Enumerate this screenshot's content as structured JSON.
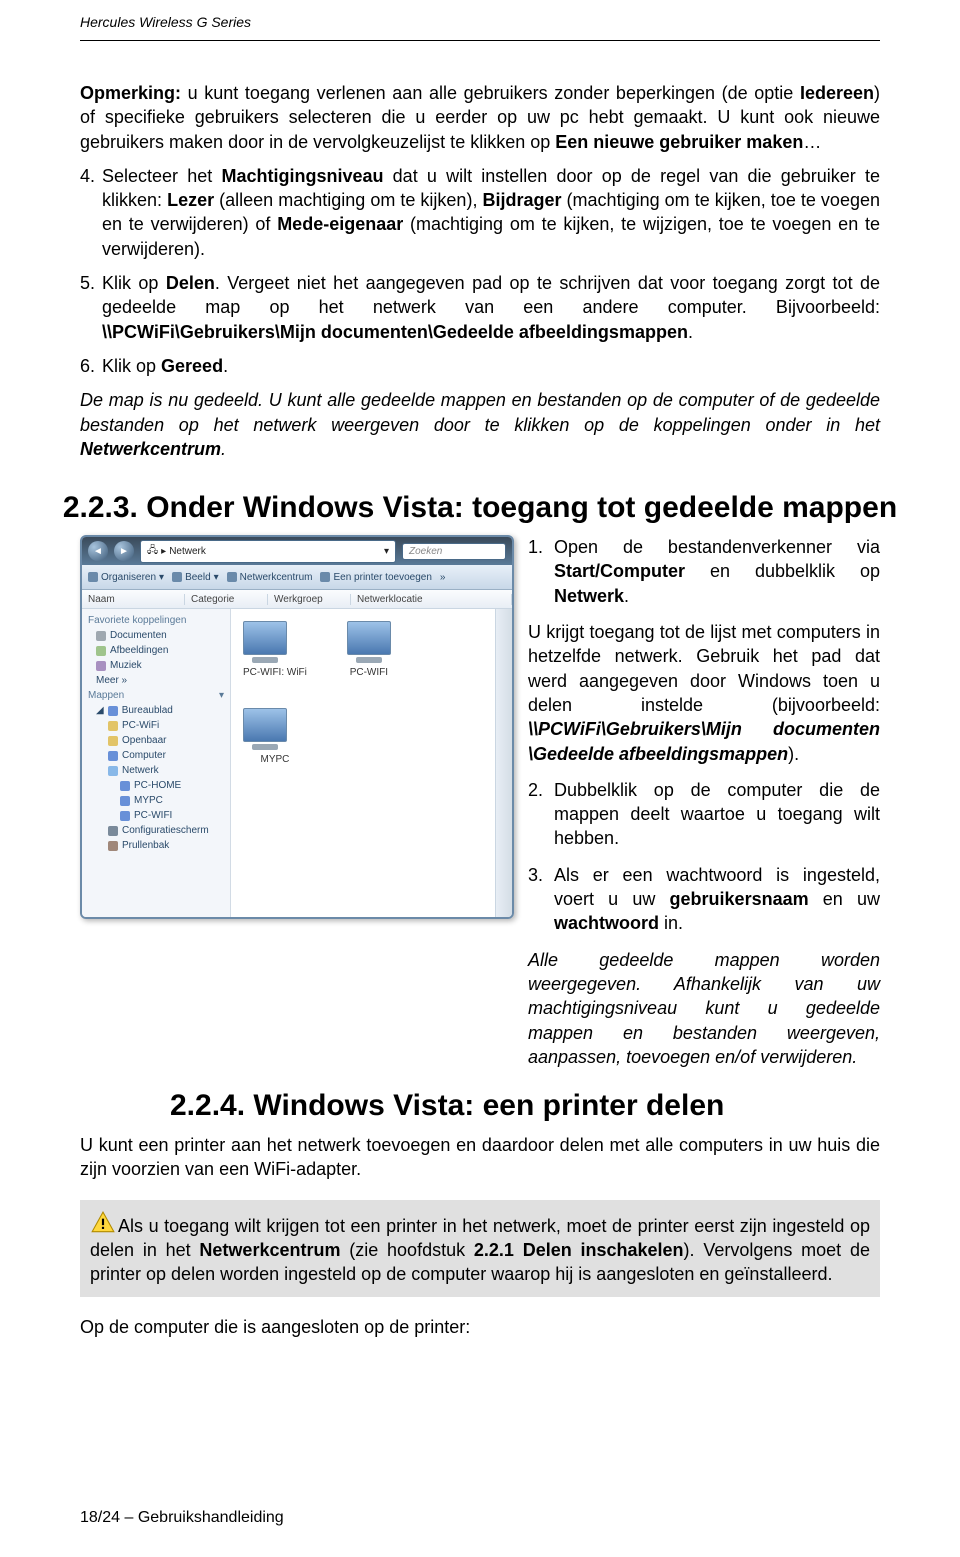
{
  "header": {
    "series": "Hercules Wireless G Series"
  },
  "body": {
    "p1_prefix": "Opmerking:",
    "p1_rest": " u kunt toegang verlenen aan alle gebruikers zonder beperkingen (de optie ",
    "p1_bold": "Iedereen",
    "p1_rest2": ") of specifieke gebruikers selecteren die u eerder op uw pc hebt gemaakt. U kunt ook nieuwe gebruikers maken door in de vervolgkeuzelijst te klikken op ",
    "p1_bold2": "Een nieuwe gebruiker maken",
    "p1_rest3": "…",
    "item4_num": "4.",
    "item4_a": "Selecteer het ",
    "item4_b": "Machtigingsniveau",
    "item4_c": " dat u wilt instellen door op de regel van die gebruiker te klikken: ",
    "item4_d": "Lezer",
    "item4_e": " (alleen machtiging om te kijken), ",
    "item4_f": "Bijdrager",
    "item4_g": " (machtiging om te kijken, toe te voegen en te verwijderen) of ",
    "item4_h": "Mede-eigenaar",
    "item4_i": " (machtiging om te kijken, te wijzigen, toe te voegen en te verwijderen).",
    "item5_num": "5.",
    "item5_a": "Klik op ",
    "item5_b": "Delen",
    "item5_c": ". Vergeet niet het aangegeven pad op te schrijven dat voor toegang zorgt tot de gedeelde map op het netwerk van een andere computer. Bijvoorbeeld: ",
    "item5_d": "\\\\PCWiFi\\Gebruikers\\Mijn documenten\\Gedeelde afbeeldingsmappen",
    "item5_e": ".",
    "item6_num": "6.",
    "item6_a": "Klik op ",
    "item6_b": "Gereed",
    "item6_c": ".",
    "p_final_a": "De map is nu gedeeld. U kunt alle gedeelde mappen en bestanden op de computer of de gedeelde bestanden op het netwerk weergeven door te klikken op de koppelingen onder in het ",
    "p_final_b": "Netwerkcentrum",
    "p_final_c": "."
  },
  "section223": {
    "title": "2.2.3. Onder Windows Vista: toegang tot gedeelde mappen",
    "right": {
      "i1_n": "1.",
      "i1_a": "Open de bestandenverkenner via ",
      "i1_b": "Start/Computer",
      "i1_c": " en dubbelklik op ",
      "i1_d": "Netwerk",
      "i1_e": ".",
      "p2_a": "U krijgt toegang tot de lijst met computers in hetzelfde netwerk. Gebruik het pad dat werd aangegeven door Windows toen u delen instelde (bijvoorbeeld: ",
      "p2_b": "\\\\PCWiFi\\Gebruikers\\Mijn documenten \\Gedeelde afbeeldingsmappen",
      "p2_c": ").",
      "i2_n": "2.",
      "i2_a": "Dubbelklik op de computer die de mappen deelt waartoe u toegang wilt hebben.",
      "i3_n": "3.",
      "i3_a": "Als er een wachtwoord is ingesteld, voert u uw ",
      "i3_b": "gebruikersnaam",
      "i3_c": " en uw ",
      "i3_d": "wachtwoord",
      "i3_e": " in.",
      "p3": "Alle gedeelde mappen worden weergegeven. Afhankelijk van uw machtigingsniveau kunt u gedeelde mappen en bestanden weergeven, aanpassen, toevoegen en/of verwijderen."
    }
  },
  "section224": {
    "title": "2.2.4. Windows Vista: een printer delen",
    "intro": "U kunt een printer aan het netwerk toevoegen en daardoor delen met alle computers in uw huis die zijn voorzien van een WiFi-adapter."
  },
  "highlight": {
    "a": "Als u toegang wilt krijgen tot een printer in het netwerk, moet de printer eerst zijn ingesteld op delen in het ",
    "b": "Netwerkcentrum",
    "c": " (zie hoofdstuk ",
    "d": "2.2.1 Delen inschakelen",
    "e": "). Vervolgens moet de printer op delen worden ingesteld op de computer waarop hij is aangesloten en geïnstalleerd."
  },
  "footer_line": {
    "a": "Op de computer die is aangesloten op de printer:"
  },
  "page_footer": {
    "pagenum": "18/24 – ",
    "title": "Gebruikshandleiding"
  },
  "explorer": {
    "breadcrumb_icon": "▸",
    "breadcrumb": "Netwerk",
    "search": "Zoeken",
    "toolbar": [
      "Organiseren",
      "Beeld",
      "Netwerkcentrum",
      "Een printer toevoegen",
      "»"
    ],
    "columns": [
      "Naam",
      "Categorie",
      "Werkgroep",
      "Netwerklocatie"
    ],
    "sidebar": {
      "fav_head": "Favoriete koppelingen",
      "fav": [
        "Documenten",
        "Afbeeldingen",
        "Muziek",
        "Meer »"
      ],
      "maps_head": "Mappen",
      "tree_root": "Bureaublad",
      "tree": [
        "PC-WiFi",
        "Openbaar",
        "Computer",
        "Netwerk",
        "PC-HOME",
        "MYPC",
        "PC-WIFI",
        "Configuratiescherm",
        "Prullenbak"
      ]
    },
    "content": {
      "pc1": "PC-WIFI: WiFi",
      "pc2": "MYPC",
      "pc3": "PC-WIFI"
    }
  }
}
